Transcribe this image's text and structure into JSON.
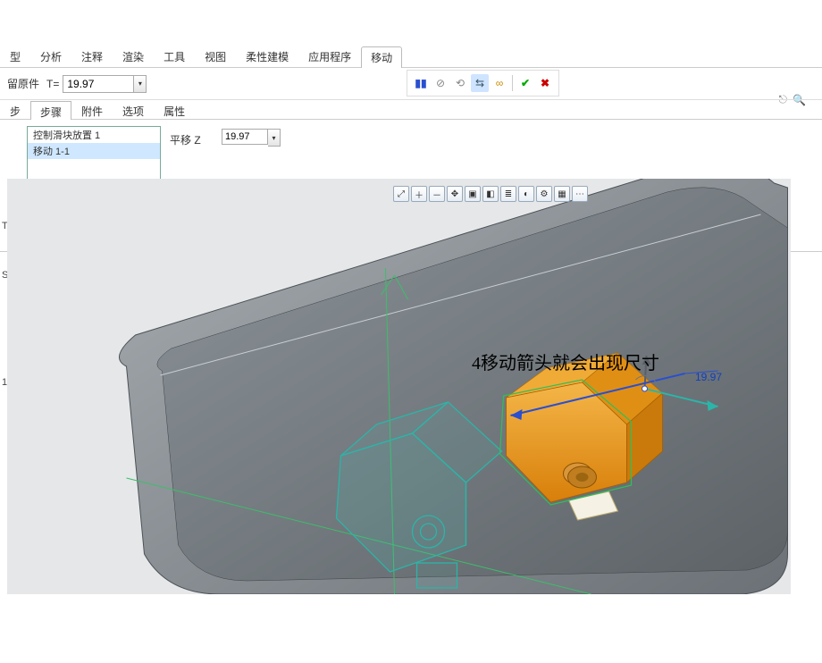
{
  "ribbon": {
    "tabs": [
      "分析",
      "注释",
      "渲染",
      "工具",
      "视图",
      "柔性建模",
      "应用程序",
      "移动"
    ],
    "leading_partial": "型",
    "active": "移动"
  },
  "topright": {
    "share_icon": "share-icon",
    "search_icon": "search-icon"
  },
  "toolbar": {
    "keep_original_label": "留原件",
    "t_label": "T=",
    "t_value": "19.97",
    "actions": {
      "pause": "pause-icon",
      "no_entry": "no-entry-icon",
      "reverse": "reverse-icon",
      "swap": "swap-icon",
      "link": "glasses-icon",
      "accept": "accept-icon",
      "cancel": "cancel-icon"
    }
  },
  "panel": {
    "tabs": [
      "步",
      "步骤",
      "附件",
      "选项",
      "属性"
    ],
    "active": "步骤",
    "list": {
      "items": [
        "控制滑块放置 1",
        "移动 1-1"
      ],
      "selected_index": 1
    },
    "translate_label": "平移 Z",
    "translate_value": "19.97"
  },
  "left_edge": {
    "label1": "T",
    "label2": "S_D",
    "label3": "1"
  },
  "view_toolbar": {
    "buttons": [
      "zoom-fit",
      "zoom-in",
      "zoom-out",
      "pan",
      "section",
      "named-view",
      "layers",
      "appearance",
      "filter-1",
      "filter-2",
      "filter-3"
    ]
  },
  "annotation": "4移动箭头就会出现尺寸",
  "dimension_value": "19.97",
  "colors": {
    "tray": "#8f969c",
    "tray_inner": "#7a8187",
    "part_solid": "#e69a1f",
    "part_ghost": "#3bbfb8",
    "axis_z": "#5a5f6a",
    "axis_move": "#2a4fd0",
    "axis_alt": "#2bb5a8"
  }
}
